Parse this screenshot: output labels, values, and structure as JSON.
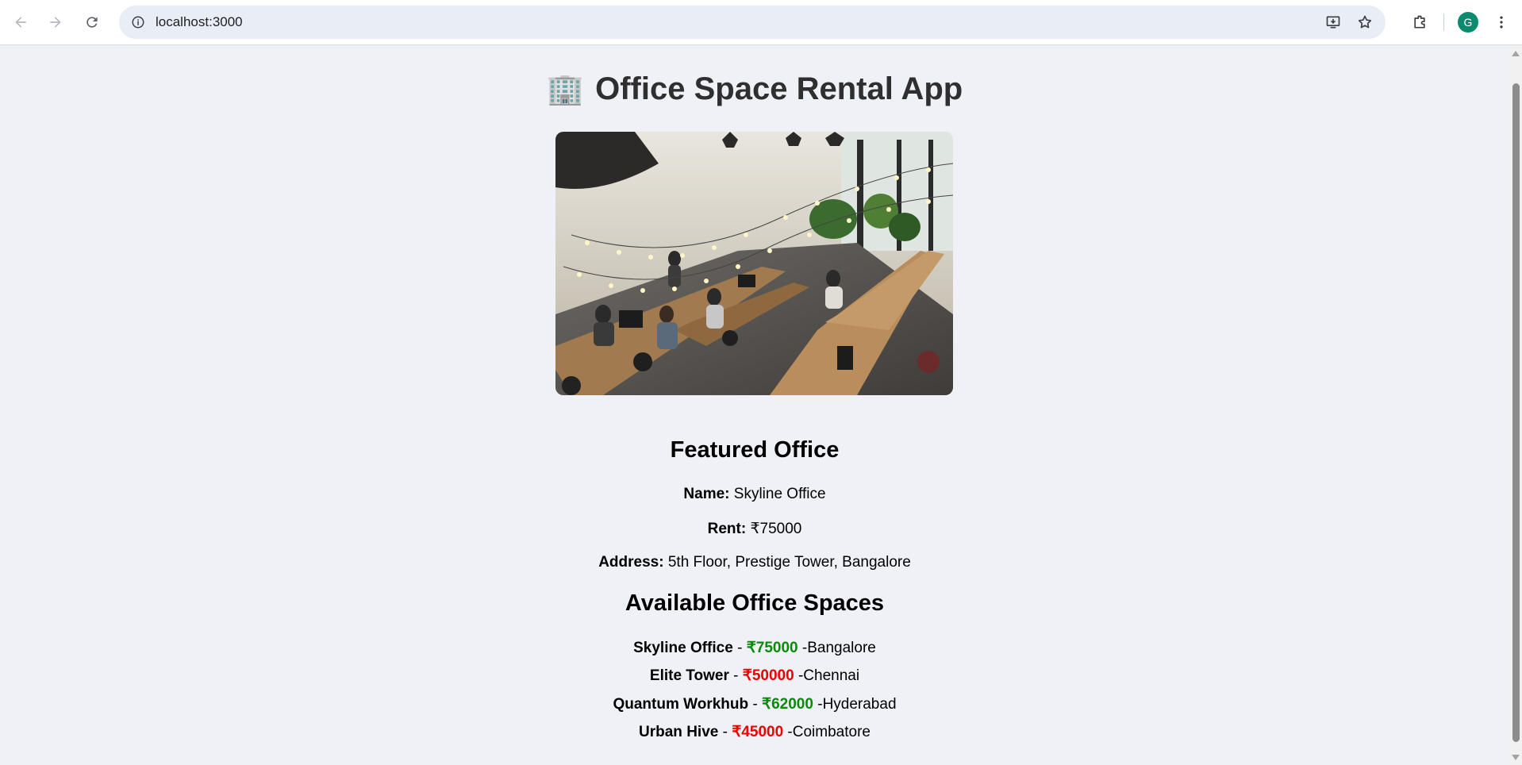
{
  "browser": {
    "url": "localhost:3000",
    "avatar_letter": "G"
  },
  "app": {
    "title_emoji": "🏢",
    "title": "Office Space Rental App"
  },
  "featured": {
    "heading": "Featured Office",
    "name_label": "Name:",
    "name_value": "Skyline Office",
    "rent_label": "Rent:",
    "rent_value": "₹75000",
    "address_label": "Address:",
    "address_value": "5th Floor, Prestige Tower, Bangalore"
  },
  "available": {
    "heading": "Available Office Spaces",
    "items": [
      {
        "name": "Skyline Office",
        "price": "₹75000",
        "city": "Bangalore",
        "price_color": "green"
      },
      {
        "name": "Elite Tower",
        "price": "₹50000",
        "city": "Chennai",
        "price_color": "red"
      },
      {
        "name": "Quantum Workhub",
        "price": "₹62000",
        "city": "Hyderabad",
        "price_color": "green"
      },
      {
        "name": "Urban Hive",
        "price": "₹45000",
        "city": "Coimbatore",
        "price_color": "red"
      }
    ]
  },
  "colors": {
    "page_bg": "#eff1f6",
    "price_high": "#0a8a0a",
    "price_low": "#ee0000"
  }
}
